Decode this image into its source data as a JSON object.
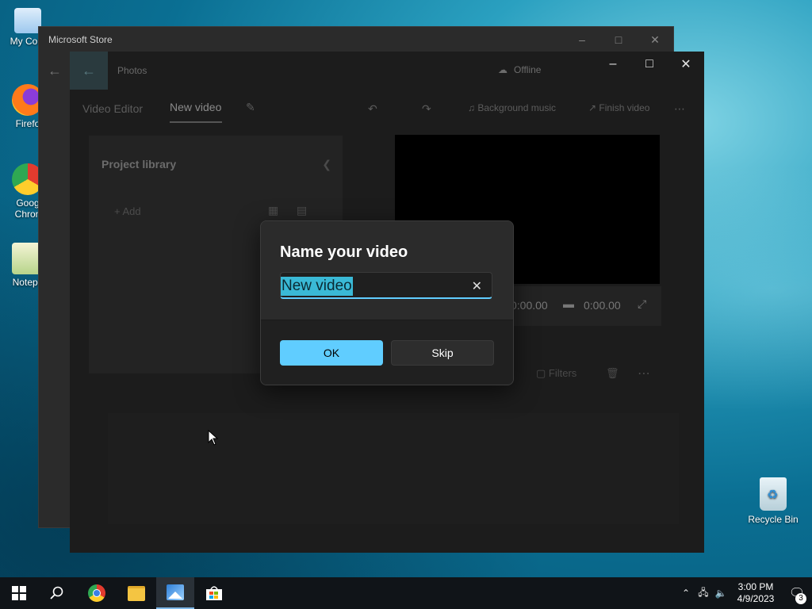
{
  "desktop": {
    "icons": [
      {
        "label": "My Com"
      },
      {
        "label": "Firefo"
      },
      {
        "label": "Goog\nChron"
      },
      {
        "label": "Notepa"
      }
    ],
    "recycle_bin": "Recycle Bin"
  },
  "store_window": {
    "title": "Microsoft Store"
  },
  "photos_window": {
    "app_name": "Photos",
    "status": "Offline",
    "toolbar": {
      "video_editor": "Video Editor",
      "project_name": "New video",
      "background_music": "Background music",
      "finish_video": "Finish video"
    },
    "library": {
      "title": "Project library",
      "add": "Add"
    },
    "time_start": "0:00.00",
    "time_end": "0:00.00",
    "filters": "Filters"
  },
  "dialog": {
    "title": "Name your video",
    "input_value": "New video",
    "ok": "OK",
    "skip": "Skip"
  },
  "taskbar": {
    "time": "3:00 PM",
    "date": "4/9/2023",
    "notification_count": "3"
  }
}
